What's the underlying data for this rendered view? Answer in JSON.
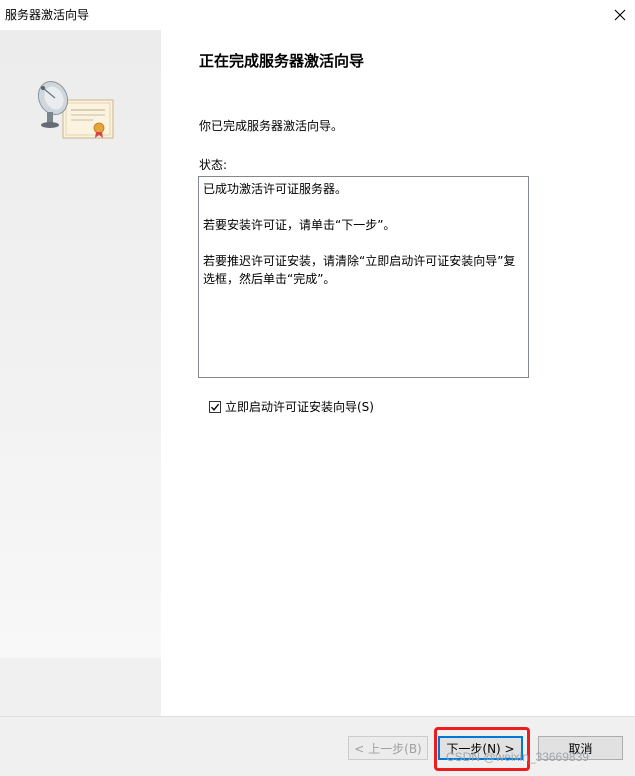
{
  "window": {
    "title": "服务器激活向导",
    "close_glyph": "✕"
  },
  "page": {
    "heading": "正在完成服务器激活向导",
    "intro": "你已完成服务器激活向导。",
    "status_label": "状态:",
    "status_lines": [
      "已成功激活许可证服务器。",
      "若要安装许可证，请单击“下一步”。",
      "若要推迟许可证安装，请清除“立即启动许可证安装向导”复选框，然后单击“完成”。"
    ],
    "checkbox": {
      "label": "立即启动许可证安装向导(S)",
      "checked": true
    }
  },
  "buttons": {
    "back": "< 上一步(B)",
    "next": "下一步(N) >",
    "cancel": "取消"
  },
  "watermark": "CSDN @weixin_33669839",
  "colors": {
    "accent": "#0078d7",
    "highlight": "#ee1c1c"
  },
  "icons": [
    "satellite-dish-icon",
    "certificate-icon",
    "checkmark-icon",
    "close-icon"
  ]
}
